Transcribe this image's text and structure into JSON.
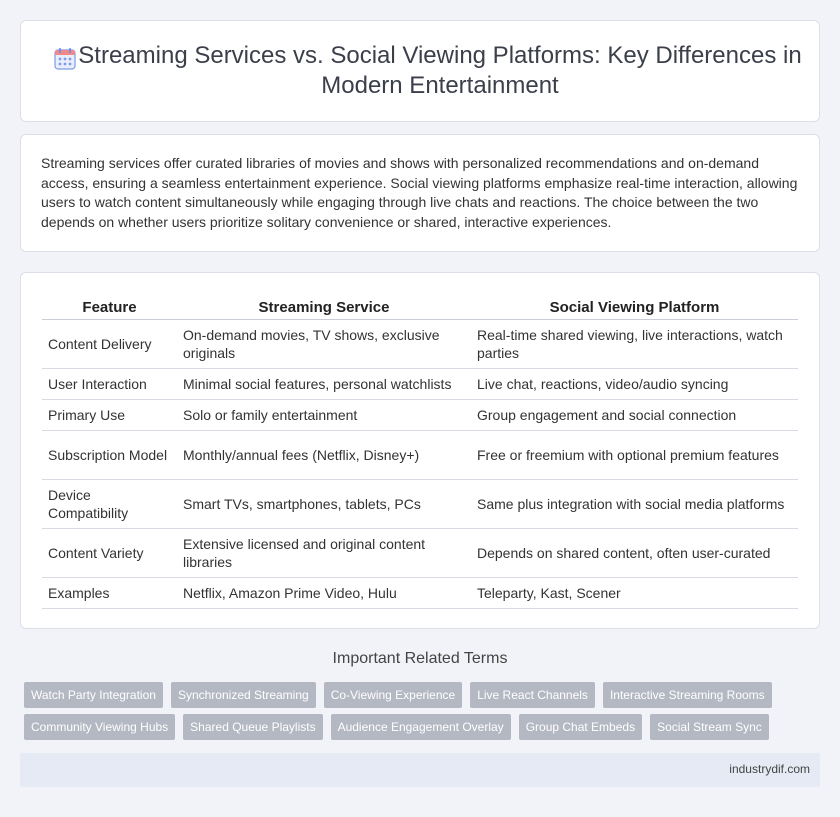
{
  "header": {
    "title": "Streaming Services vs. Social Viewing Platforms: Key Differences in Modern Entertainment",
    "icon": "calendar-grid-icon",
    "icon_color": "#6d8de8"
  },
  "intro": {
    "text": "Streaming services offer curated libraries of movies and shows with personalized recommendations and on-demand access, ensuring a seamless entertainment experience. Social viewing platforms emphasize real-time interaction, allowing users to watch content simultaneously while engaging through live chats and reactions. The choice between the two depends on whether users prioritize solitary convenience or shared, interactive experiences."
  },
  "table": {
    "headers": [
      "Feature",
      "Streaming Service",
      "Social Viewing Platform"
    ],
    "rows": [
      [
        "Content Delivery",
        "On-demand movies, TV shows, exclusive originals",
        "Real-time shared viewing, live interactions, watch parties"
      ],
      [
        "User Interaction",
        "Minimal social features, personal watchlists",
        "Live chat, reactions, video/audio syncing"
      ],
      [
        "Primary Use",
        "Solo or family entertainment",
        "Group engagement and social connection"
      ],
      [
        "Subscription Model",
        "Monthly/annual fees (Netflix, Disney+)",
        "Free or freemium with optional premium features"
      ],
      [
        "Device Compatibility",
        "Smart TVs, smartphones, tablets, PCs",
        "Same plus integration with social media platforms"
      ],
      [
        "Content Variety",
        "Extensive licensed and original content libraries",
        "Depends on shared content, often user-curated"
      ],
      [
        "Examples",
        "Netflix, Amazon Prime Video, Hulu",
        "Teleparty, Kast, Scener"
      ]
    ]
  },
  "related": {
    "heading": "Important Related Terms",
    "tags_row1": [
      "Watch Party Integration",
      "Synchronized Streaming",
      "Co-Viewing Experience",
      "Live React Channels",
      "Interactive Streaming Rooms"
    ],
    "tags_row2": [
      "Community Viewing Hubs",
      "Shared Queue Playlists",
      "Audience Engagement Overlay",
      "Group Chat Embeds",
      "Social Stream Sync"
    ]
  },
  "footer": {
    "site": "industrydif.com"
  }
}
